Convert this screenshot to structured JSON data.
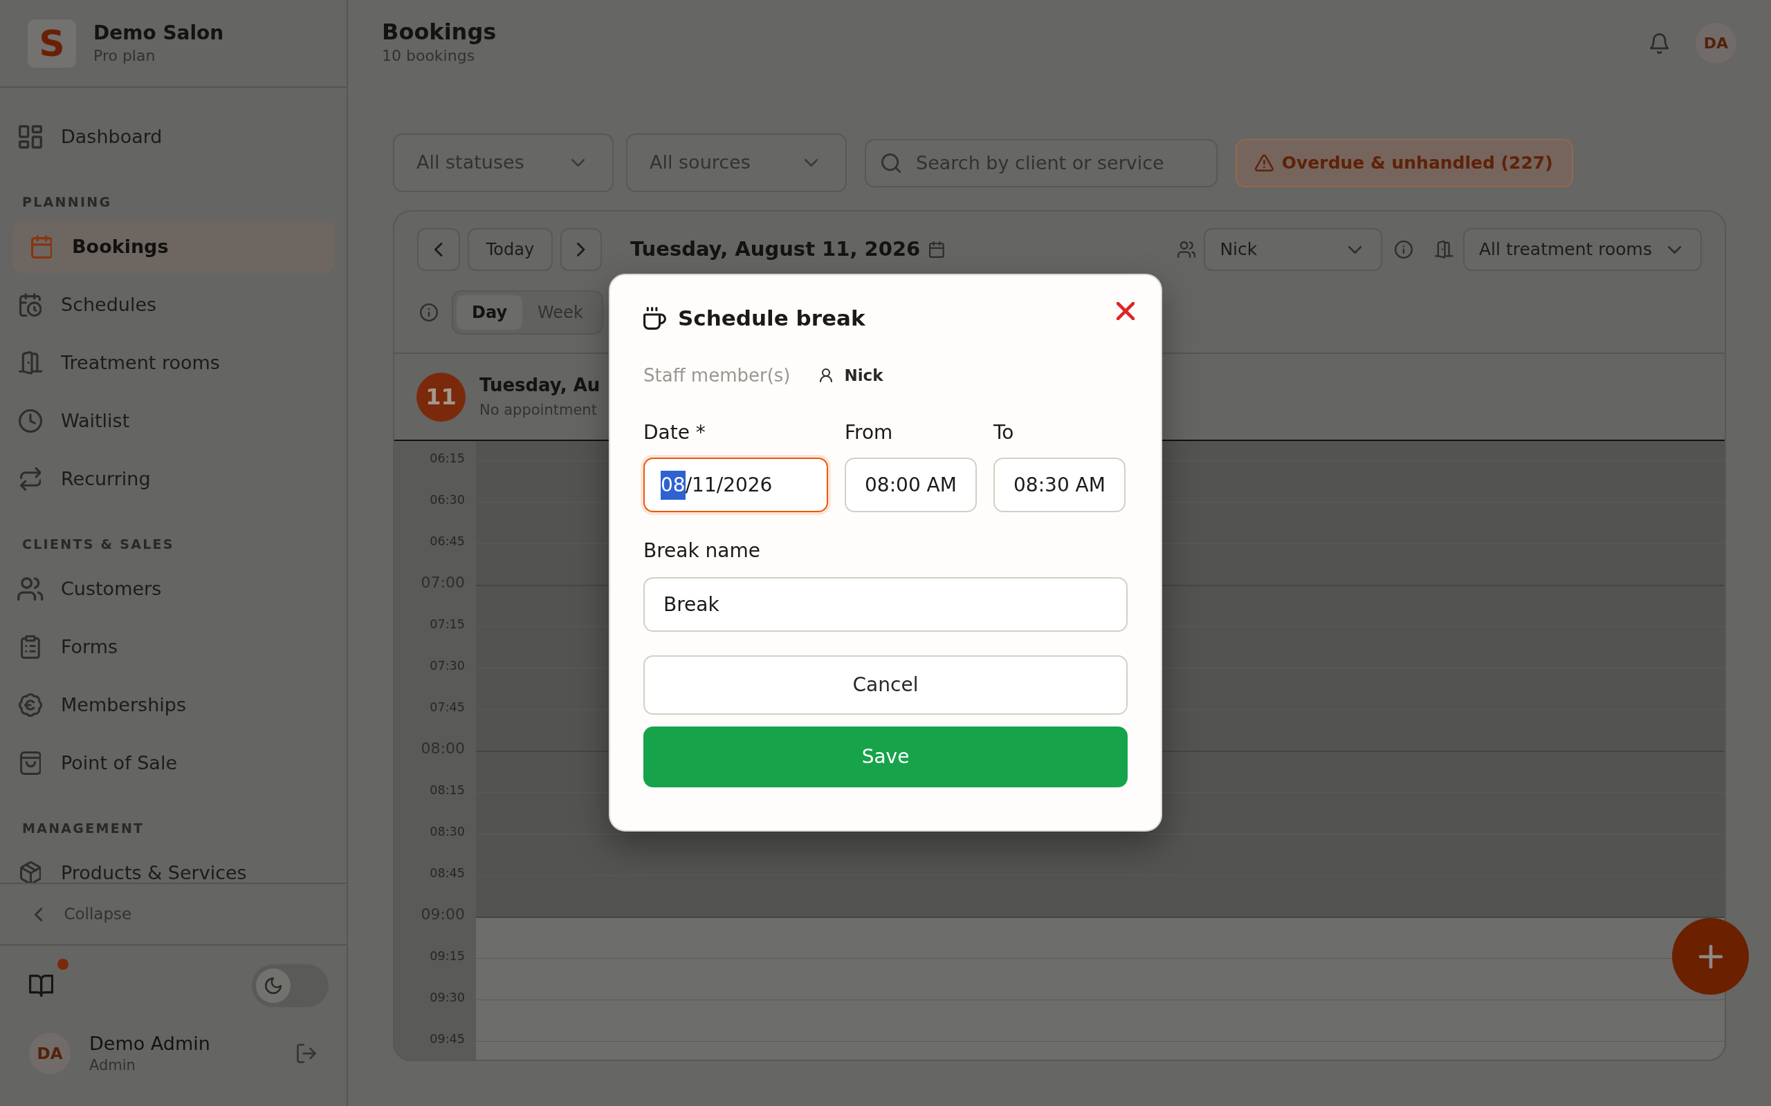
{
  "sidebar": {
    "brand": {
      "logo_letter": "S",
      "name": "Demo Salon",
      "plan": "Pro plan"
    },
    "sections": [
      {
        "items": [
          {
            "label": "Dashboard",
            "selected": false
          }
        ]
      },
      {
        "title": "PLANNING",
        "items": [
          {
            "label": "Bookings",
            "selected": true
          },
          {
            "label": "Schedules",
            "selected": false
          },
          {
            "label": "Treatment rooms",
            "selected": false
          },
          {
            "label": "Waitlist",
            "selected": false
          },
          {
            "label": "Recurring",
            "selected": false
          }
        ]
      },
      {
        "title": "CLIENTS & SALES",
        "items": [
          {
            "label": "Customers",
            "selected": false
          },
          {
            "label": "Forms",
            "selected": false
          },
          {
            "label": "Memberships",
            "selected": false
          },
          {
            "label": "Point of Sale",
            "selected": false
          }
        ]
      },
      {
        "title": "MANAGEMENT",
        "items": [
          {
            "label": "Products & Services",
            "selected": false
          }
        ]
      }
    ],
    "collapse": "Collapse",
    "footer": {
      "guide_unread": true,
      "dark_mode": false,
      "user": {
        "initials": "DA",
        "name": "Demo Admin",
        "role": "Admin"
      }
    }
  },
  "header": {
    "title": "Bookings",
    "subtitle": "10 bookings",
    "avatar": "DA"
  },
  "filters": {
    "status": "All statuses",
    "source": "All sources",
    "search": {
      "placeholder": "Search by client or service"
    },
    "overdue": "Overdue & unhandled (227)"
  },
  "calendar": {
    "today": "Today",
    "date": "Tuesday, August 11, 2026",
    "staff": "Nick",
    "rooms": "All treatment rooms",
    "views": [
      {
        "label": "Day",
        "selected": true
      },
      {
        "label": "Week",
        "selected": false
      }
    ],
    "day": {
      "number": "11",
      "title": "Tuesday, Au",
      "subtitle": "No appointment"
    },
    "slots": [
      {
        "kind": "hour",
        "available": false
      },
      {
        "label": "06:15",
        "kind": "quarter",
        "available": false
      },
      {
        "label": "06:30",
        "kind": "quarter",
        "available": false
      },
      {
        "label": "06:45",
        "kind": "quarter",
        "available": false
      },
      {
        "label": "07:00",
        "kind": "hour",
        "available": false
      },
      {
        "label": "07:15",
        "kind": "quarter",
        "available": false
      },
      {
        "label": "07:30",
        "kind": "quarter",
        "available": false
      },
      {
        "label": "07:45",
        "kind": "quarter",
        "available": false
      },
      {
        "label": "08:00",
        "kind": "hour",
        "available": false
      },
      {
        "label": "08:15",
        "kind": "quarter",
        "available": false
      },
      {
        "label": "08:30",
        "kind": "quarter",
        "available": false
      },
      {
        "label": "08:45",
        "kind": "quarter",
        "available": false
      },
      {
        "label": "09:00",
        "kind": "hour",
        "available": true
      },
      {
        "label": "09:15",
        "kind": "quarter",
        "available": true
      },
      {
        "label": "09:30",
        "kind": "quarter",
        "available": true
      },
      {
        "label": "09:45",
        "kind": "quarter",
        "available": true
      }
    ]
  },
  "modal": {
    "title": "Schedule break",
    "staff_label": "Staff member(s)",
    "staff": [
      {
        "name": "Nick"
      }
    ],
    "date": {
      "label": "Date *",
      "focused": true,
      "parts": [
        {
          "text": "08",
          "selected": true
        },
        {
          "text": "/11/2026",
          "selected": false
        }
      ]
    },
    "from": {
      "label": "From",
      "value": "08:00 AM"
    },
    "to": {
      "label": "To",
      "value": "08:30 AM"
    },
    "break_name": {
      "label": "Break name",
      "value": "Break"
    },
    "cancel": "Cancel",
    "save": "Save"
  }
}
